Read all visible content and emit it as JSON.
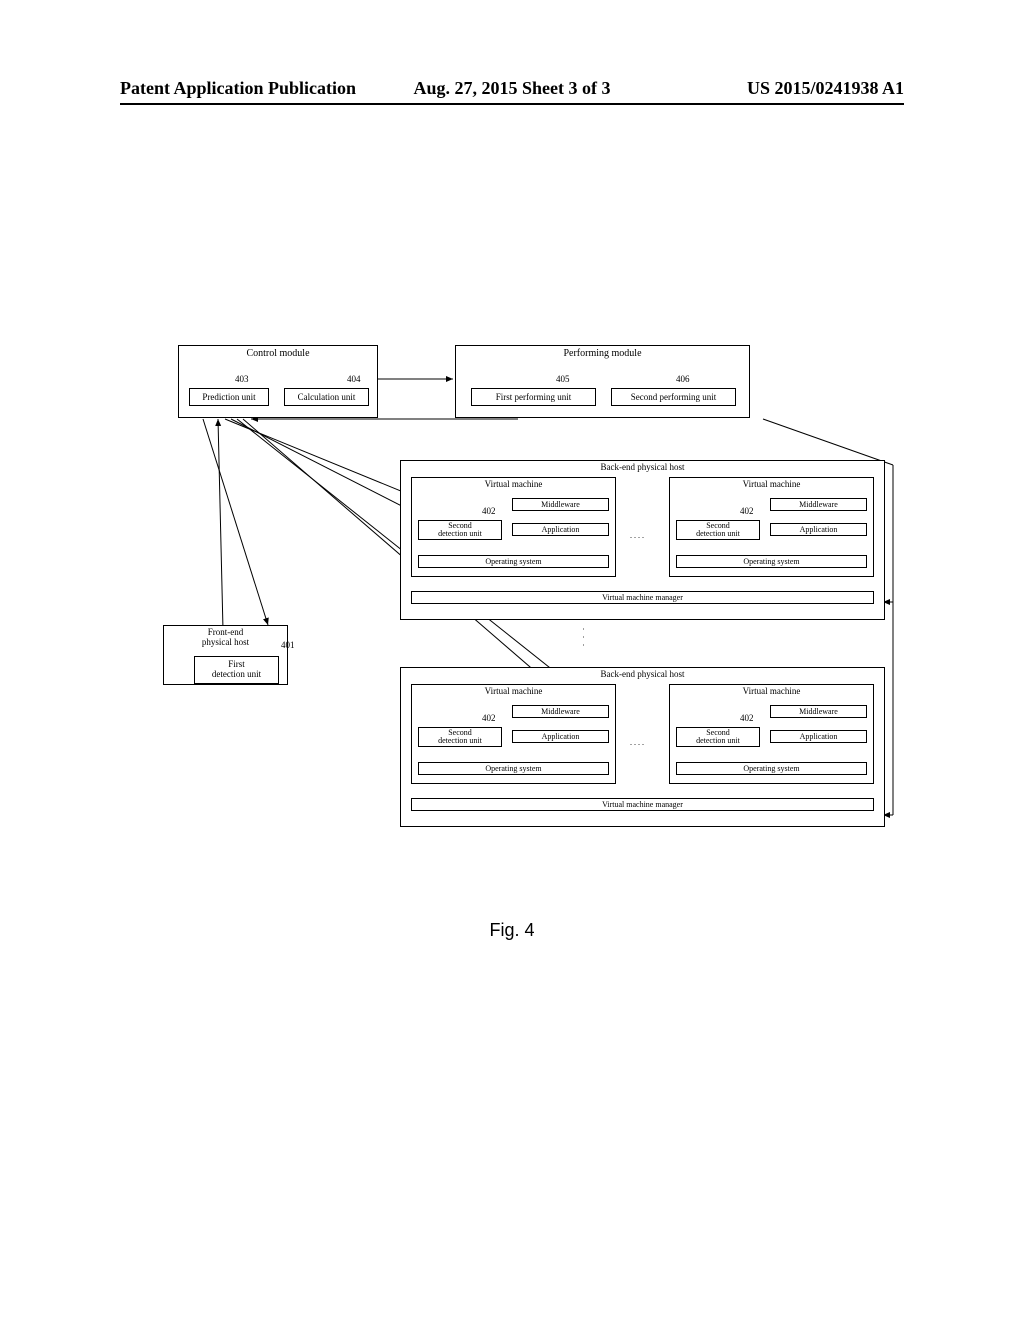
{
  "header": {
    "left": "Patent Application Publication",
    "center": "Aug. 27, 2015  Sheet 3 of 3",
    "right": "US 2015/0241938 A1"
  },
  "control_module": {
    "title": "Control module",
    "prediction": {
      "label": "Prediction unit",
      "ref": "403"
    },
    "calculation": {
      "label": "Calculation unit",
      "ref": "404"
    }
  },
  "performing_module": {
    "title": "Performing module",
    "first": {
      "label": "First performing unit",
      "ref": "405"
    },
    "second": {
      "label": "Second performing unit",
      "ref": "406"
    }
  },
  "frontend": {
    "title": "Front-end\nphysical host",
    "unit": {
      "label": "First\ndetection unit",
      "ref": "401"
    }
  },
  "backend": {
    "title": "Back-end physical host",
    "vm_title": "Virtual machine",
    "second_detection": {
      "label": "Second\ndetection unit",
      "ref": "402"
    },
    "middleware": "Middleware",
    "application": "Application",
    "os": "Operating system",
    "vmm": "Virtual machine manager"
  },
  "caption": "Fig. 4"
}
